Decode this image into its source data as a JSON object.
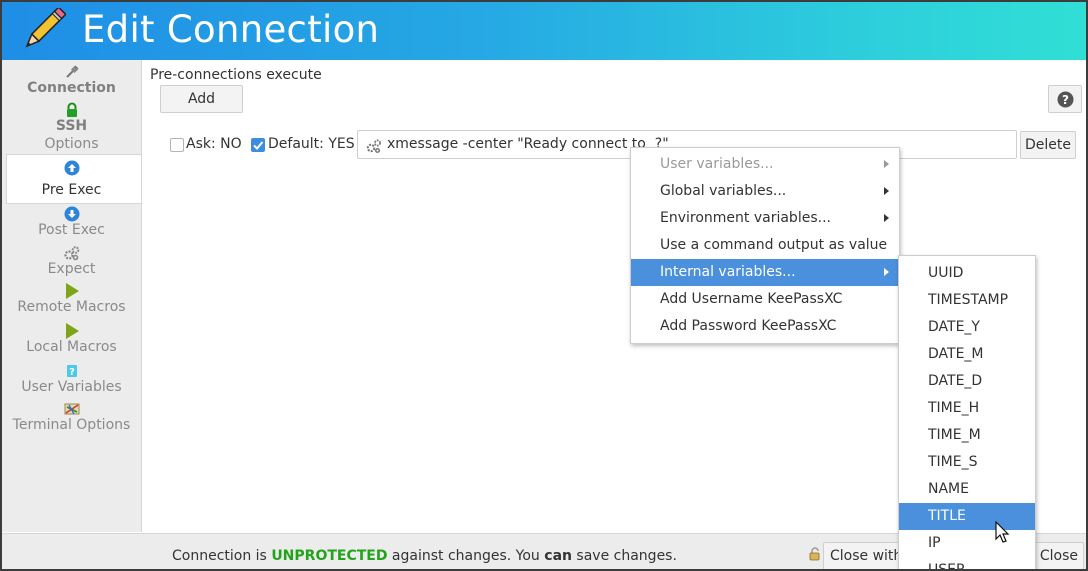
{
  "window": {
    "title": "Edit Connection"
  },
  "sidebar": {
    "items": [
      {
        "label": "Connection",
        "icon": "plug-icon"
      },
      {
        "label": "SSH",
        "icon": "lock-icon"
      },
      {
        "label": "Options"
      },
      {
        "label": "Pre Exec",
        "icon": "arrow-up-circle-icon"
      },
      {
        "label": "Post Exec",
        "icon": "arrow-down-circle-icon"
      },
      {
        "label": "Expect",
        "icon": "gears-icon"
      },
      {
        "label": "Remote Macros",
        "icon": "play-icon"
      },
      {
        "label": "Local Macros",
        "icon": "play-icon"
      },
      {
        "label": "User Variables",
        "icon": "question-box-icon"
      },
      {
        "label": "Terminal Options",
        "icon": "terminal-options-icon"
      }
    ]
  },
  "main": {
    "section_label": "Pre-connections execute",
    "add_label": "Add",
    "help_icon": "help-icon",
    "ask_label": "Ask: NO",
    "default_label": "Default: YES",
    "command_value": "xmessage -center \"Ready connect to  ?\"",
    "delete_label": "Delete"
  },
  "context_menu": {
    "items": [
      {
        "label": "User variables...",
        "disabled": true,
        "submenu": true
      },
      {
        "label": "Global variables...",
        "submenu": true
      },
      {
        "label": "Environment variables...",
        "submenu": true
      },
      {
        "label": "Use a command output as value"
      },
      {
        "label": "Internal variables...",
        "submenu": true,
        "selected": true
      },
      {
        "label": "Add Username KeePassXC"
      },
      {
        "label": "Add Password KeePassXC"
      }
    ]
  },
  "submenu": {
    "items": [
      "UUID",
      "TIMESTAMP",
      "DATE_Y",
      "DATE_M",
      "DATE_D",
      "TIME_H",
      "TIME_M",
      "TIME_S",
      "NAME",
      "TITLE",
      "IP",
      "USER"
    ],
    "selected": "TITLE"
  },
  "statusbar": {
    "prefix": "Connection is ",
    "state": "UNPROTECTED",
    "middle": " against changes. You ",
    "can": "can",
    "suffix": " save changes.",
    "close_without_label": "Close with",
    "close_label": "d Close"
  },
  "colors": {
    "header_start": "#1f8ee6",
    "header_end": "#31dfd5",
    "selection": "#4a90dd",
    "unprotected": "#22a31a"
  }
}
